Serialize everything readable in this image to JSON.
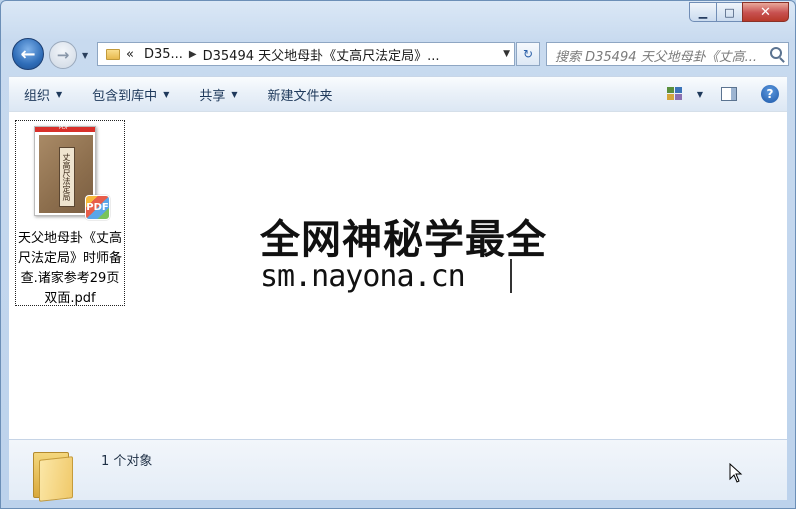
{
  "window": {
    "minimize_glyph": "▁",
    "maximize_glyph": "□",
    "close_glyph": "✕"
  },
  "nav": {
    "back_glyph": "←",
    "forward_glyph": "→",
    "history_glyph": "▼",
    "address_overflow": "«",
    "breadcrumb_1": "D35...",
    "breadcrumb_2": "D35494 天父地母卦《丈高尺法定局》...",
    "address_dropdown": "▼",
    "refresh_glyph": "↻",
    "search_placeholder": "搜索 D35494 天父地母卦《丈高..."
  },
  "commands": {
    "organize": "组织",
    "include_in_library": "包含到库中",
    "share": "共享",
    "new_folder": "新建文件夹",
    "help": "?"
  },
  "file": {
    "badge": "PDF",
    "thumb_band": "PDF",
    "thumb_title": "丈高尺法定局",
    "name": "天父地母卦《丈高尺法定局》时师备查.诸家参考29页双面.pdf"
  },
  "watermark": {
    "line1": "全网神秘学最全",
    "line2": "sm.nayona.cn"
  },
  "details": {
    "count_text": "1 个对象"
  }
}
